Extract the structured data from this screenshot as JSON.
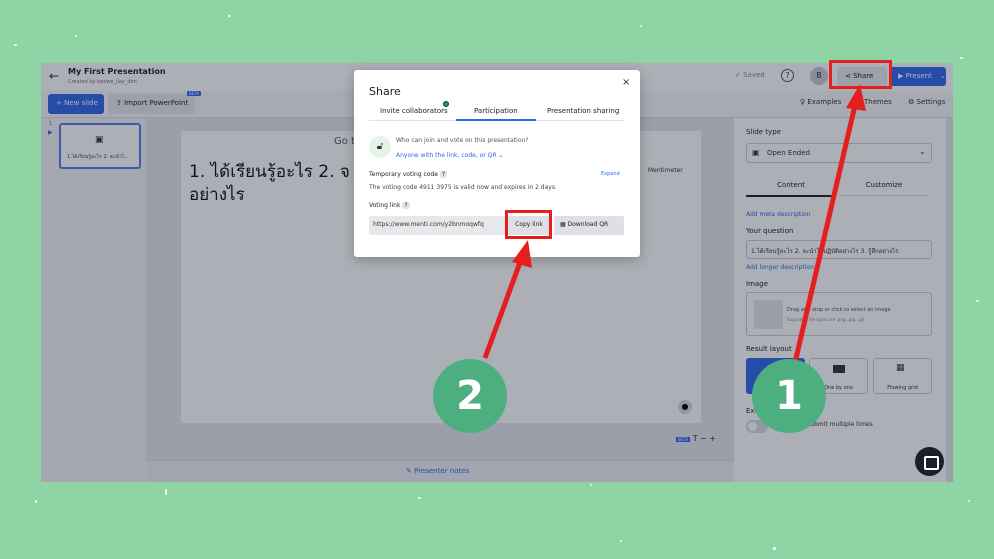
{
  "app": {
    "title": "My First Presentation",
    "subtitle": "Created by baowe_jiay_dim",
    "saved": "✓ Saved",
    "avatar_initial": "B",
    "share_label": "Share",
    "present_label": "Present",
    "new_slide_label": "+ New slide",
    "import_label": "Import PowerPoint",
    "beta_label": "BETA",
    "examples_label": "Examples",
    "themes_label": "Themes",
    "settings_label": "Settings"
  },
  "thumbnail": {
    "number": "1",
    "text": "1.ได้เรียนรู้อะไร 2. จะนำไ..."
  },
  "slide": {
    "hint": "Go to",
    "question_visible": "1. ได้เรียนรู้อะไร 2. จ อย่างไร",
    "brand": "Mentimeter",
    "notes_label": "Presenter notes",
    "beta_label": "BETA",
    "text_tools": "T  −  +"
  },
  "right_panel": {
    "slide_type_label": "Slide type",
    "slide_type_value": "Open Ended",
    "tab_content": "Content",
    "tab_customize": "Customize",
    "add_meta": "Add meta description",
    "your_question_label": "Your question",
    "question_value": "1.ได้เรียนรู้อะไร 2. จะนำไปปฏิบัติอย่างไร 3. รู้สึกอย่างไร",
    "add_longer": "Add longer description",
    "image_label": "Image",
    "drop_text": "Drag and drop or click to select an image",
    "drop_sub": "Supported file types are .png, .jpg, .gif",
    "result_layout_label": "Result layout",
    "layouts": [
      "",
      "One by one",
      "Flowing grid"
    ],
    "extras_label": "Extras",
    "multi_submit": "Participants submit multiple times"
  },
  "share_dialog": {
    "title": "Share",
    "close": "×",
    "tabs": [
      "Invite collaborators",
      "Participation",
      "Presentation sharing"
    ],
    "active_tab": "Participation",
    "who_label": "Who can join and vote on this presentation?",
    "who_value": "Anyone with the link, code, or QR",
    "code_label": "Temporary voting code",
    "expand": "Expand",
    "code_desc": "The voting code 4911 3975 is valid now and expires in 2 days.",
    "voting_link_label": "Voting link",
    "voting_link": "https://www.menti.com/y2bnmoqwfq",
    "copy_link": "Copy link",
    "download_qr": "Download QR"
  },
  "annotations": {
    "step1": "1",
    "step2": "2",
    "color": "#e41f1f"
  }
}
